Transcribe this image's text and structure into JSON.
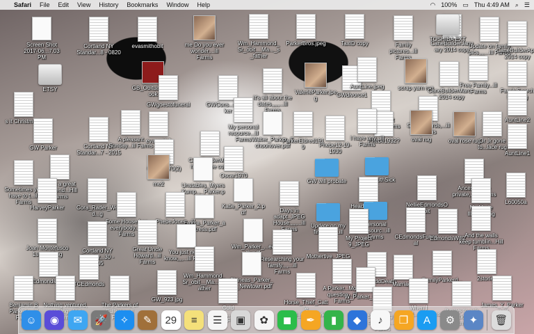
{
  "menubar": {
    "app": "Safari",
    "menus": [
      "File",
      "Edit",
      "View",
      "History",
      "Bookmarks",
      "Window",
      "Help"
    ],
    "battery": "100%",
    "clock": "Thu 4:49 AM"
  },
  "icons": [
    {
      "label": "Screen Shot 2017-06...7.03 PM",
      "kind": "blank"
    },
    {
      "label": "Cortland NY Standar...8 - 0820",
      "kind": "doc"
    },
    {
      "label": "evasmithobit",
      "kind": "doc"
    },
    {
      "label": "me\nDo you ever wonder,...ill Farms",
      "kind": "photo"
    },
    {
      "label": "Wm_Hammond_Sr_obit__Ma..._s_father",
      "kind": "doc"
    },
    {
      "label": "ParkerBros.jpeg",
      "kind": "doc"
    },
    {
      "label": "TaxID copy",
      "kind": "doc"
    },
    {
      "label": "Family pictures...ill Farms",
      "kind": "doc"
    },
    {
      "label": "CaneBuilderJanuary 2014 copy",
      "kind": "doc"
    },
    {
      "label": "TOSHIBA EXT",
      "kind": "drive"
    },
    {
      "label": "Update on family pics,,,,...ill Farms",
      "kind": "doc"
    },
    {
      "label": "CaneBuilderApril2014 copy",
      "kind": "doc"
    },
    {
      "label": "ETSY",
      "kind": "drive"
    },
    {
      "label": "GB_Obituary_Ebook",
      "kind": "red"
    },
    {
      "label": "GWgoestofuneral",
      "kind": "doc"
    },
    {
      "label": "GWCons...er_Parker",
      "kind": "doc"
    },
    {
      "label": "It's all about the dates,,,,,...ill Farms",
      "kind": "doc"
    },
    {
      "label": "ValerieParker.jpeg",
      "kind": "photo"
    },
    {
      "label": "GWdivorce1",
      "kind": "doc"
    },
    {
      "label": "AuntLine.jpeg",
      "kind": "doc"
    },
    {
      "label": "scrap yarn rug",
      "kind": "photo"
    },
    {
      "label": "CaneBuilderMarch 2014 copy",
      "kind": "doc"
    },
    {
      "label": "Free Family...ill Farms",
      "kind": "doc"
    },
    {
      "label": "FamilySearch Indexing",
      "kind": "doc"
    },
    {
      "label": "s it Christmas?",
      "kind": "doc"
    },
    {
      "label": "My personal resource...ill Farms",
      "kind": "doc"
    },
    {
      "label": "Great Aunt Edith...ill Farms",
      "kind": "doc"
    },
    {
      "label": "SSDI records,...ill Farms",
      "kind": "doc"
    },
    {
      "label": "AuntLine2",
      "kind": "doc"
    },
    {
      "label": "GW Parker",
      "kind": "doc"
    },
    {
      "label": "Cortland NY Standar...7 - 2015",
      "kind": "doc"
    },
    {
      "label": "A pleasant Sunday...ill Farms",
      "kind": "doc"
    },
    {
      "label": "evasmith2",
      "kind": "doc"
    },
    {
      "label": "Walter_Parker_Schoonover.pdf",
      "kind": "blank"
    },
    {
      "label": "ParkerEldred1919",
      "kind": "doc"
    },
    {
      "label": "Phebe12-19-1930",
      "kind": "doc"
    },
    {
      "label": "Phebe1932?",
      "kind": "doc"
    },
    {
      "label": "I have any...ill Farms",
      "kind": "doc"
    },
    {
      "label": "oval rug",
      "kind": "photo"
    },
    {
      "label": "oval rose rug",
      "kind": "photo"
    },
    {
      "label": "Or Jr gone to...lace rug",
      "kind": "doc"
    },
    {
      "label": "AuntLine1",
      "kind": "doc"
    },
    {
      "label": "CaneBuilderMarch blueblue copy",
      "kind": "doc"
    },
    {
      "label": "Oscar1970(2)",
      "kind": "doc"
    },
    {
      "label": "Oscar1970",
      "kind": "doc"
    },
    {
      "label": "Sometimes you have to t...ill Farms",
      "kind": "doc"
    },
    {
      "label": "What a great weekend...Hill Farms",
      "kind": "doc"
    },
    {
      "label": "me2",
      "kind": "photo"
    },
    {
      "label": "Unstables_Myers Kump..._Parker.pdf",
      "kind": "blank"
    },
    {
      "label": "GW will probate",
      "kind": "folder"
    },
    {
      "label": "Geo&RuthSick",
      "kind": "folder"
    },
    {
      "label": "Ancestry tree private,...ill Farms",
      "kind": "doc"
    },
    {
      "label": "HarveyParker",
      "kind": "doc"
    },
    {
      "label": "Cora_Rader_Wed...g",
      "kind": "doc"
    },
    {
      "label": "Katie_Parker_2.pdf",
      "kind": "blank"
    },
    {
      "label": "Days in adapt_JPEG House,,,,,...ill Farms",
      "kind": "doc"
    },
    {
      "label": "Header_JPEG",
      "kind": "doc"
    },
    {
      "label": "NellieEdmondsObit",
      "kind": "doc"
    },
    {
      "label": "My Made IllIIIlE...png",
      "kind": "doc"
    },
    {
      "label": "L60050a",
      "kind": "doc"
    },
    {
      "label": "Some House has everybody...ill Farms",
      "kind": "doc"
    },
    {
      "label": "PhebeJones...ill",
      "kind": "doc"
    },
    {
      "label": "Emma_Parker_actress.pdf",
      "kind": "blank"
    },
    {
      "label": "Update on my findings,...ill Farms",
      "kind": "folder"
    },
    {
      "label": "Personal Resourc...ill Farms",
      "kind": "folder"
    },
    {
      "label": "My Project 9_JPEG",
      "kind": "doc"
    },
    {
      "label": "CEdmondsFuneral",
      "kind": "doc"
    },
    {
      "label": "EdmondsWill2",
      "kind": "doc"
    },
    {
      "label": "And the walls keep tumblin...Hill Farms",
      "kind": "doc"
    },
    {
      "label": "Joan Montefusco 1st wedding",
      "kind": "doc"
    },
    {
      "label": "Cortland NY Standar...30 - 1105",
      "kind": "doc"
    },
    {
      "label": "Great Uncle Howard...ill Farms",
      "kind": "doc"
    },
    {
      "label": "You just never know,,,,...ill Farms",
      "kind": "blank"
    },
    {
      "label": "Wm_Parker_...eath.pdf",
      "kind": "blank"
    },
    {
      "label": "Researching your family,,,,...ill Farms",
      "kind": "doc"
    },
    {
      "label": "Mothertive_JPEG",
      "kind": "doc"
    },
    {
      "label": "EdmondsWill",
      "kind": "doc"
    },
    {
      "label": "TCEdmonds",
      "kind": "doc"
    },
    {
      "label": "Wm_Hammond_Sr_obit__Ma...e_father",
      "kind": "doc"
    },
    {
      "label": "Phineas_Parker_Jr_Newtown.pdf",
      "kind": "blank"
    },
    {
      "label": "GeoStiddDeath",
      "kind": "doc"
    },
    {
      "label": "Marriage",
      "kind": "doc"
    },
    {
      "label": "FamilyParkerd...",
      "kind": "doc"
    },
    {
      "label": "2stories",
      "kind": "doc"
    },
    {
      "label": "Benjamin B Parker's...ill Farms",
      "kind": "doc"
    },
    {
      "label": "Nothing ventured, nothing...Hill Farms",
      "kind": "doc"
    },
    {
      "label": "The Parkers of Sullivan...ill Farms",
      "kind": "doc"
    },
    {
      "label": "GW_923.jpg",
      "kind": "doc"
    },
    {
      "label": "Cold calling,,,,,...Candle Hill Farms",
      "kind": "doc"
    },
    {
      "label": "Horse_Thief_Cattle Read_GW_Parker",
      "kind": "doc"
    },
    {
      "label": "A Parker...More question...ill Farms",
      "kind": "doc"
    },
    {
      "label": "W_Parker_Cottle",
      "kind": "doc"
    },
    {
      "label": "Searching a common...ill Farms",
      "kind": "doc"
    },
    {
      "label": "When I started,...ill Farms",
      "kind": "doc"
    },
    {
      "label": "It pays to ask question...ill Farms",
      "kind": "doc"
    },
    {
      "label": "James_Y_Parker_obit",
      "kind": "doc"
    }
  ],
  "dock": [
    {
      "name": "finder-icon",
      "glyph": "☺",
      "color": "#2f8fe8"
    },
    {
      "name": "siri-icon",
      "glyph": "◉",
      "color": "#5a4dd8"
    },
    {
      "name": "messages-icon",
      "glyph": "✉",
      "color": "#3ea6f2"
    },
    {
      "name": "launchpad-icon",
      "glyph": "🚀",
      "color": "#7a7a7a"
    },
    {
      "name": "safari-icon",
      "glyph": "✧",
      "color": "#1c8ef0"
    },
    {
      "name": "notes-book-icon",
      "glyph": "✎",
      "color": "#a0703a"
    },
    {
      "name": "calendar-icon",
      "glyph": "29",
      "color": "#ffffff"
    },
    {
      "name": "notes-icon",
      "glyph": "≡",
      "color": "#f4e07a"
    },
    {
      "name": "reminders-icon",
      "glyph": "☰",
      "color": "#f5f5f5"
    },
    {
      "name": "preview-icon",
      "glyph": "▣",
      "color": "#d8d8d8"
    },
    {
      "name": "photos-icon",
      "glyph": "✿",
      "color": "#f5f5f5"
    },
    {
      "name": "facetime-icon",
      "glyph": "◼",
      "color": "#2bbd4a"
    },
    {
      "name": "pages-icon",
      "glyph": "✒",
      "color": "#f5a623"
    },
    {
      "name": "numbers-icon",
      "glyph": "▮",
      "color": "#34b44a"
    },
    {
      "name": "keynote-icon",
      "glyph": "◆",
      "color": "#2d74da"
    },
    {
      "name": "itunes-icon",
      "glyph": "♪",
      "color": "#f7f7f7"
    },
    {
      "name": "ibooks-icon",
      "glyph": "❐",
      "color": "#f5a623"
    },
    {
      "name": "app-store-icon",
      "glyph": "A",
      "color": "#1a9cf2"
    },
    {
      "name": "system-preferences-icon",
      "glyph": "⚙",
      "color": "#8a8a8a"
    },
    {
      "name": "image-capture-icon",
      "glyph": "✦",
      "color": "#5b86c5"
    },
    {
      "name": "trash-icon",
      "glyph": "🗑",
      "color": "#dcdcdc"
    }
  ],
  "calendar_day": "29"
}
